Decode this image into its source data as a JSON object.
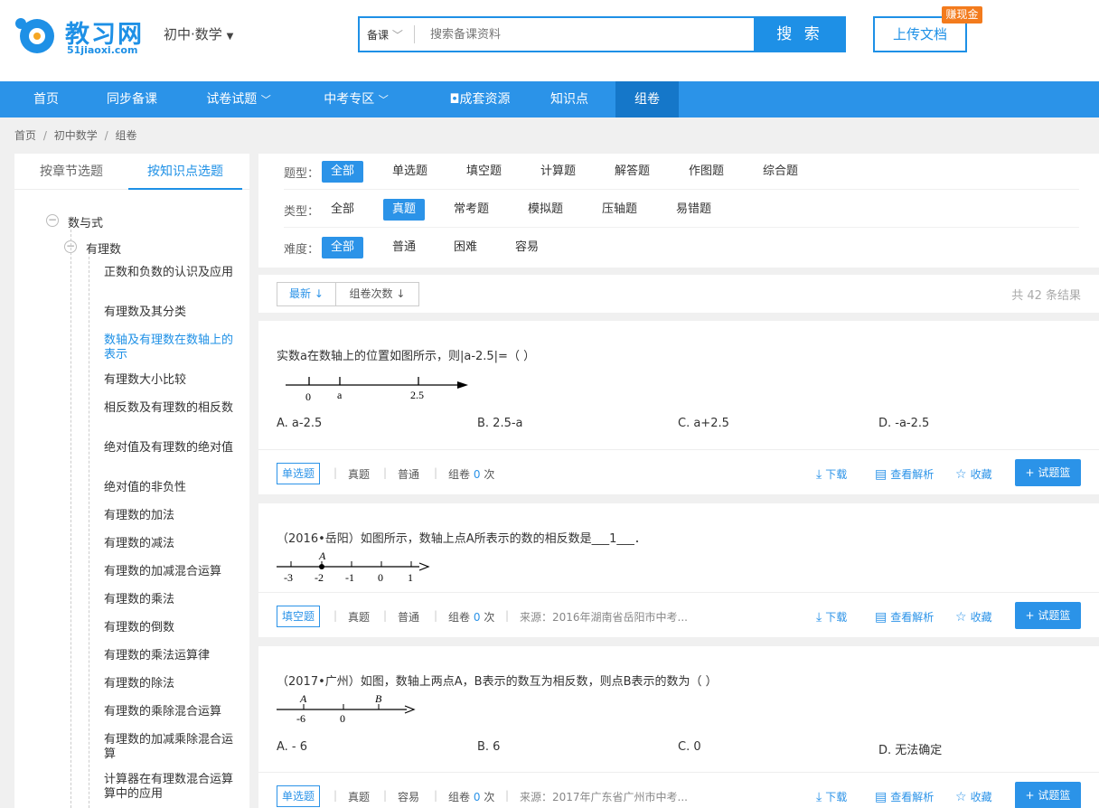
{
  "header": {
    "logo_text": "教习网",
    "logo_sub": "51jiaoxi.com",
    "subject": "初中·数学",
    "search_type": "备课",
    "search_placeholder": "搜索备课资料",
    "search_button": "搜 索",
    "upload_label": "上传文档",
    "badge": "赚现金"
  },
  "nav": [
    "首页",
    "同步备课",
    "试卷试题",
    "中考专区",
    "成套资源",
    "知识点",
    "组卷"
  ],
  "breadcrumb": [
    "首页",
    "/",
    "初中数学",
    "/",
    "组卷"
  ],
  "left_tabs": [
    "按章节选题",
    "按知识点选题"
  ],
  "tree": {
    "root": "数与式",
    "child": "有理数",
    "leaves": [
      "正数和负数的认识及应用",
      "有理数及其分类",
      "数轴及有理数在数轴上的表示",
      "有理数大小比较",
      "相反数及有理数的相反数",
      "绝对值及有理数的绝对值",
      "绝对值的非负性",
      "有理数的加法",
      "有理数的减法",
      "有理数的加减混合运算",
      "有理数的乘法",
      "有理数的倒数",
      "有理数的乘法运算律",
      "有理数的除法",
      "有理数的乘除混合运算",
      "有理数的加减乘除混合运算",
      "计算器在有理数混合运算算中的应用"
    ]
  },
  "filters": {
    "type_label": "题型：",
    "types": [
      "全部",
      "单选题",
      "填空题",
      "计算题",
      "解答题",
      "作图题",
      "综合题"
    ],
    "kind_label": "类型：",
    "kinds": [
      "全部",
      "真题",
      "常考题",
      "模拟题",
      "压轴题",
      "易错题"
    ],
    "level_label": "难度：",
    "levels": [
      "全部",
      "普通",
      "困难",
      "容易"
    ]
  },
  "sort": {
    "newest": "最新",
    "times": "组卷次数",
    "count": "共 42 条结果"
  },
  "questions": [
    {
      "text": "实数a在数轴上的位置如图所示，则|a-2.5|=（   ）",
      "opts": [
        "A.  a-2.5",
        "B.  2.5-a",
        "C.  a+2.5",
        "D.  -a-2.5"
      ],
      "tag": "单选题",
      "kind": "真题",
      "level": "普通",
      "times_label": "组卷",
      "times": "0",
      "times_unit": "次",
      "source": ""
    },
    {
      "text": "（2016•岳阳）如图所示，数轴上点A所表示的数的相反数是___1___．",
      "opts": [],
      "tag": "填空题",
      "kind": "真题",
      "level": "普通",
      "times_label": "组卷",
      "times": "0",
      "times_unit": "次",
      "source": "来源：2016年湖南省岳阳市中考..."
    },
    {
      "text": "（2017•广州）如图，数轴上两点A，B表示的数互为相反数，则点B表示的数为（     ）",
      "opts": [
        "A.  - 6",
        "B.  6",
        "C.  0",
        "D.  无法确定"
      ],
      "tag": "单选题",
      "kind": "真题",
      "level": "容易",
      "times_label": "组卷",
      "times": "0",
      "times_unit": "次",
      "source": "来源：2017年广东省广州市中考..."
    }
  ],
  "actions": {
    "download": "下载",
    "analysis": "查看解析",
    "collect": "收藏",
    "add": "试题篮"
  },
  "axes": {
    "q1": [
      "0",
      "a",
      "2.5"
    ],
    "q2": [
      "A",
      "-3",
      "-2",
      "-1",
      "0",
      "1"
    ],
    "q3": [
      "A",
      "B",
      "-6",
      "0"
    ]
  },
  "colors": {
    "brand": "#2b93e8",
    "nav_active": "#1577c9",
    "badge": "#f37b1d"
  }
}
